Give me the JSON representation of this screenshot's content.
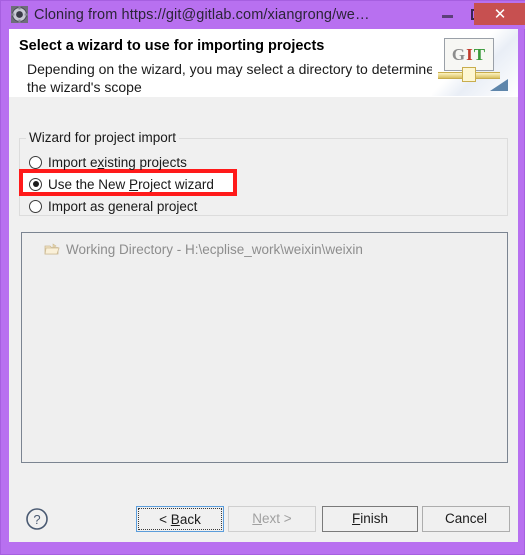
{
  "window": {
    "title": "Cloning from https://git@gitlab.com/xiangrong/we…",
    "icon": "gear-icon",
    "controls": {
      "minimize": "–",
      "maximize": "□",
      "close": "✕"
    },
    "frame_color": "#b870f0"
  },
  "header": {
    "title": "Select a wizard to use for importing projects",
    "description": "Depending on the wizard, you may select a directory to determine the wizard's scope",
    "graphic": {
      "name": "git-banner-icon",
      "letter_g": "G",
      "letter_i": "I",
      "letter_t": "T"
    }
  },
  "group": {
    "title": "Wizard for project import",
    "options": [
      {
        "id": "import-existing-projects",
        "label_before": "Import e",
        "label_mnemonic": "x",
        "label_after": "isting projects",
        "selected": false
      },
      {
        "id": "use-new-project-wizard",
        "label_before": "Use the New ",
        "label_mnemonic": "P",
        "label_after": "roject wizard",
        "selected": true
      },
      {
        "id": "import-as-general-project",
        "label_before": "Import as ",
        "label_mnemonic": "g",
        "label_after": "eneral project",
        "selected": false
      }
    ]
  },
  "annotation": {
    "color": "#ff1a1a",
    "target": "use-new-project-wizard"
  },
  "tree": {
    "item_icon": "folder-directory-icon",
    "item_label": "Working Directory - H:\\ecplise_work\\weixin\\weixin",
    "enabled": false
  },
  "buttons": {
    "help": "?",
    "back": {
      "label_before": "< ",
      "label_mnemonic": "B",
      "label_after": "ack",
      "enabled": true,
      "focused": true
    },
    "next": {
      "label_before": "",
      "label_mnemonic": "N",
      "label_after": "ext >",
      "enabled": false,
      "focused": false
    },
    "finish": {
      "label_before": "",
      "label_mnemonic": "F",
      "label_after": "inish",
      "enabled": true,
      "default": true
    },
    "cancel": {
      "label_before": "Cancel",
      "label_mnemonic": "",
      "label_after": "",
      "enabled": true,
      "default": false
    }
  }
}
